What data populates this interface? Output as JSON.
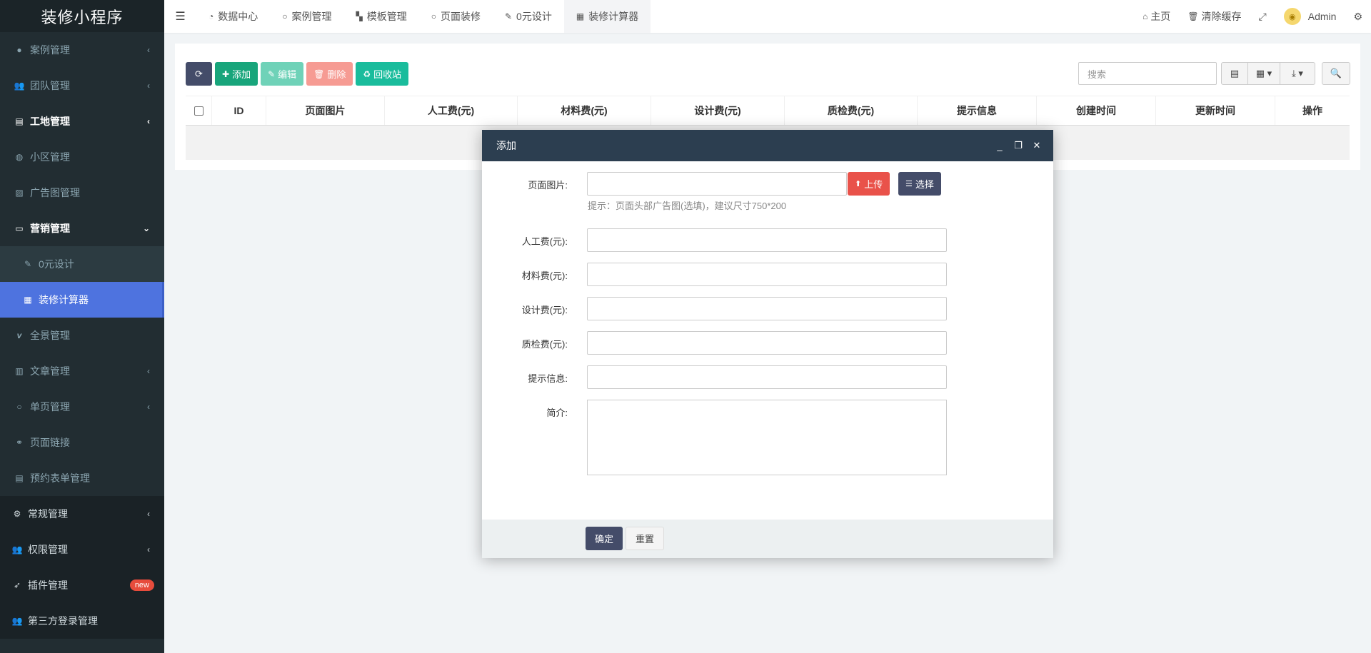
{
  "app": {
    "title": "装修小程序"
  },
  "sidebar": {
    "items": [
      {
        "label": "案例管理",
        "icon": "circle-icon",
        "arrow": "‹"
      },
      {
        "label": "团队管理",
        "icon": "users-icon",
        "arrow": "‹"
      },
      {
        "label": "工地管理",
        "icon": "building-icon",
        "arrow": "‹"
      },
      {
        "label": "小区管理",
        "icon": "globe-icon",
        "arrow": ""
      },
      {
        "label": "广告图管理",
        "icon": "image-icon",
        "arrow": ""
      },
      {
        "label": "营销管理",
        "icon": "credit-card-icon",
        "arrow": "⌄"
      },
      {
        "label": "0元设计",
        "icon": "brush-icon",
        "arrow": ""
      },
      {
        "label": "装修计算器",
        "icon": "calculator-icon",
        "arrow": ""
      },
      {
        "label": "全景管理",
        "icon": "vimeo-icon",
        "arrow": ""
      },
      {
        "label": "文章管理",
        "icon": "newspaper-icon",
        "arrow": "‹"
      },
      {
        "label": "单页管理",
        "icon": "circle-icon",
        "arrow": "‹"
      },
      {
        "label": "页面链接",
        "icon": "link-icon",
        "arrow": ""
      },
      {
        "label": "预约表单管理",
        "icon": "list-alt-icon",
        "arrow": ""
      },
      {
        "label": "常规管理",
        "icon": "cogs-icon",
        "arrow": "‹"
      },
      {
        "label": "权限管理",
        "icon": "users-icon",
        "arrow": "‹"
      },
      {
        "label": "插件管理",
        "icon": "rocket-icon",
        "badge": "new"
      },
      {
        "label": "第三方登录管理",
        "icon": "users-icon",
        "arrow": ""
      }
    ]
  },
  "topnav": {
    "tabs": [
      {
        "label": "数据中心",
        "icon": "dashboard-icon"
      },
      {
        "label": "案例管理",
        "icon": "circle-icon"
      },
      {
        "label": "模板管理",
        "icon": "chessboard-icon"
      },
      {
        "label": "页面装修",
        "icon": "circle-icon"
      },
      {
        "label": "0元设计",
        "icon": "brush-icon"
      },
      {
        "label": "装修计算器",
        "icon": "calculator-icon"
      }
    ],
    "right": {
      "home": "主页",
      "clear_cache": "清除缓存",
      "user": "Admin"
    }
  },
  "toolbar": {
    "add": "添加",
    "edit": "编辑",
    "delete": "删除",
    "recycle": "回收站",
    "search_placeholder": "搜索"
  },
  "table": {
    "columns": [
      "ID",
      "页面图片",
      "人工费(元)",
      "材料费(元)",
      "设计费(元)",
      "质检费(元)",
      "提示信息",
      "创建时间",
      "更新时间",
      "操作"
    ]
  },
  "modal": {
    "title": "添加",
    "fields": {
      "page_image": "页面图片:",
      "labor": "人工费(元):",
      "material": "材料费(元):",
      "design": "设计费(元):",
      "inspection": "质检费(元):",
      "tip": "提示信息:",
      "intro": "简介:"
    },
    "hint": "提示：页面头部广告图(选填)，建议尺寸750*200",
    "upload": "上传",
    "select": "选择",
    "confirm": "确定",
    "reset": "重置"
  },
  "colors": {
    "sidebar_bg": "#222d32",
    "active": "#4e73df",
    "add": "#18a57b",
    "upload": "#e9524a",
    "primary_dark": "#444c69",
    "modal_header": "#2c3e50"
  }
}
